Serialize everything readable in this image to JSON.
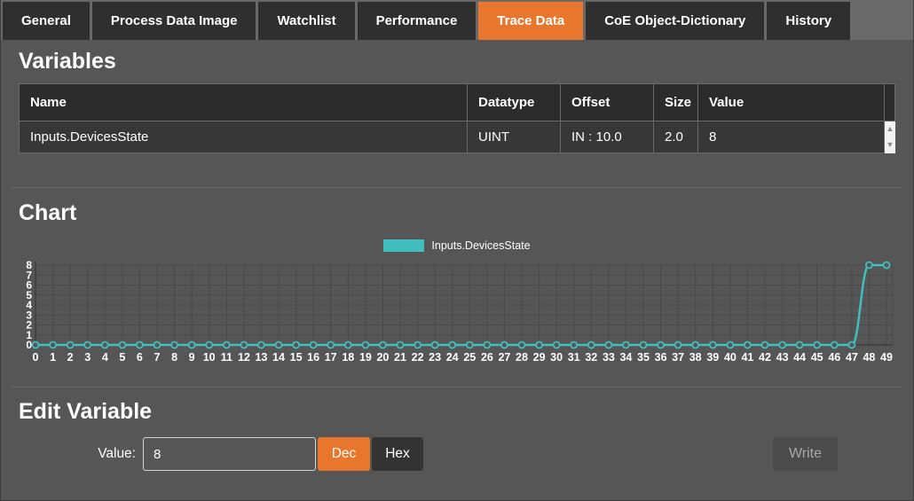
{
  "tabs": [
    {
      "label": "General",
      "active": false
    },
    {
      "label": "Process Data Image",
      "active": false
    },
    {
      "label": "Watchlist",
      "active": false
    },
    {
      "label": "Performance",
      "active": false
    },
    {
      "label": "Trace Data",
      "active": true
    },
    {
      "label": "CoE Object-Dictionary",
      "active": false
    },
    {
      "label": "History",
      "active": false
    }
  ],
  "variables": {
    "title": "Variables",
    "columns": [
      "Name",
      "Datatype",
      "Offset",
      "Size",
      "Value"
    ],
    "rows": [
      [
        "Inputs.DevicesState",
        "UINT",
        "IN : 10.0",
        "2.0",
        "8"
      ]
    ],
    "scroll_up_icon": "▲",
    "scroll_down_icon": "▼"
  },
  "chart_section_title": "Chart",
  "chart_data": {
    "type": "line",
    "title": "",
    "xlabel": "",
    "ylabel": "",
    "x": [
      0,
      1,
      2,
      3,
      4,
      5,
      6,
      7,
      8,
      9,
      10,
      11,
      12,
      13,
      14,
      15,
      16,
      17,
      18,
      19,
      20,
      21,
      22,
      23,
      24,
      25,
      26,
      27,
      28,
      29,
      30,
      31,
      32,
      33,
      34,
      35,
      36,
      37,
      38,
      39,
      40,
      41,
      42,
      43,
      44,
      45,
      46,
      47,
      48,
      49
    ],
    "series": [
      {
        "name": "Inputs.DevicesState",
        "color": "#41bfbf",
        "values": [
          0,
          0,
          0,
          0,
          0,
          0,
          0,
          0,
          0,
          0,
          0,
          0,
          0,
          0,
          0,
          0,
          0,
          0,
          0,
          0,
          0,
          0,
          0,
          0,
          0,
          0,
          0,
          0,
          0,
          0,
          0,
          0,
          0,
          0,
          0,
          0,
          0,
          0,
          0,
          0,
          0,
          0,
          0,
          0,
          0,
          0,
          0,
          0,
          8,
          8
        ]
      }
    ],
    "ylim": [
      0,
      8
    ],
    "yticks": [
      0,
      1,
      2,
      3,
      4,
      5,
      6,
      7,
      8
    ],
    "grid": true,
    "legend_position": "top-center",
    "marker": "open-circle"
  },
  "edit_variable": {
    "title": "Edit Variable",
    "value_label": "Value:",
    "value": "8",
    "dec_label": "Dec",
    "hex_label": "Hex",
    "write_label": "Write"
  },
  "colors": {
    "accent_orange": "#e8772d",
    "series_teal": "#41bfbf",
    "background": "#565656",
    "panel_dark": "#2f2f2f",
    "grid": "#494949",
    "axis": "#3c3c3c"
  }
}
